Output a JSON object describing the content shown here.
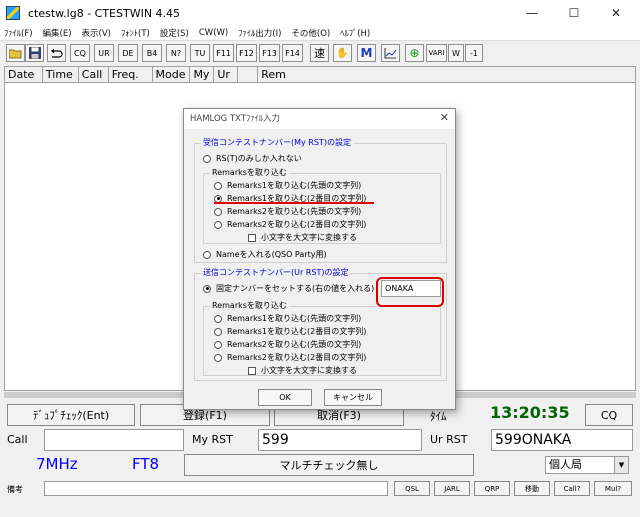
{
  "window": {
    "title": "ctestw.lg8  - CTESTWIN  4.45",
    "min": "—",
    "max": "☐",
    "close": "✕"
  },
  "menu": [
    "ﾌｧｲﾙ(F)",
    "編集(E)",
    "表示(V)",
    "ﾌｫﾝﾄ(T)",
    "設定(S)",
    "CW(W)",
    "ﾌｧｲﾙ出力(I)",
    "その他(O)",
    "ﾍﾙﾌﾟ(H)"
  ],
  "toolbar": {
    "text_buttons": [
      "CQ",
      "UR",
      "DE",
      "B4",
      "N?",
      "TU",
      "F11",
      "F12",
      "F13",
      "F14"
    ],
    "speed": "速",
    "hand": "✋",
    "m": "M",
    "graph": "📈",
    "target": "⊕",
    "vari": "VARI",
    "w": "W",
    "minus1": "-1"
  },
  "log_columns": [
    "Date",
    "Time",
    "Call",
    "Freq.",
    "Mode",
    "My",
    "Ur",
    "",
    "Rem"
  ],
  "bottom": {
    "dupe_check": "ﾃﾞｭﾌﾟﾁｪｯｸ(Ent)",
    "register": "登録(F1)",
    "cancel_f3": "取消(F3)",
    "time_label": "ﾀｲﾑ",
    "clock": "13:20:35",
    "cq_button": "CQ",
    "call_label": "Call",
    "my_rst_label": "My RST",
    "my_rst_value": "599",
    "ur_rst_label": "Ur RST",
    "ur_rst_value": "599ONAKA",
    "band": "7MHz",
    "mode": "FT8",
    "multi_check": "マルチチェック無し",
    "station": "個人局",
    "remarks_label": "備考",
    "buttons": [
      "QSL",
      "JARL",
      "QRP",
      "移動",
      "Call?",
      "Mul?"
    ]
  },
  "dialog": {
    "title": "HAMLOG TXTﾌｧｲﾙ入力",
    "close": "✕",
    "recv_group": "受信コンテストナンバー(My RST)の設定",
    "recv_rst_only": "RS(T)のみしか入れない",
    "recv_remarks_group": "Remarksを取り込む",
    "recv_options": [
      "Remarks1を取り込む(先頭の文字列)",
      "Remarks1を取り込む(2番目の文字列)",
      "Remarks2を取り込む(先頭の文字列)",
      "Remarks2を取り込む(2番目の文字列)"
    ],
    "recv_uppercase": "小文字を大文字に変換する",
    "recv_name": "Nameを入れる(QSO Party用)",
    "send_group": "送信コンテストナンバー(Ur RST)の設定",
    "send_fixed": "固定ナンバーをセットする(右の値を入れる)",
    "send_fixed_value": "ONAKA",
    "send_remarks_group": "Remarksを取り込む",
    "send_options": [
      "Remarks1を取り込む(先頭の文字列)",
      "Remarks1を取り込む(2番目の文字列)",
      "Remarks2を取り込む(先頭の文字列)",
      "Remarks2を取り込む(2番目の文字列)"
    ],
    "send_uppercase": "小文字を大文字に変換する",
    "ok": "OK",
    "cancel": "キャンセル"
  },
  "colors": {
    "annotation_red": "#e00000",
    "clock_green": "#006400",
    "band_blue": "#0000ff",
    "group_title_blue": "#0000cc"
  }
}
